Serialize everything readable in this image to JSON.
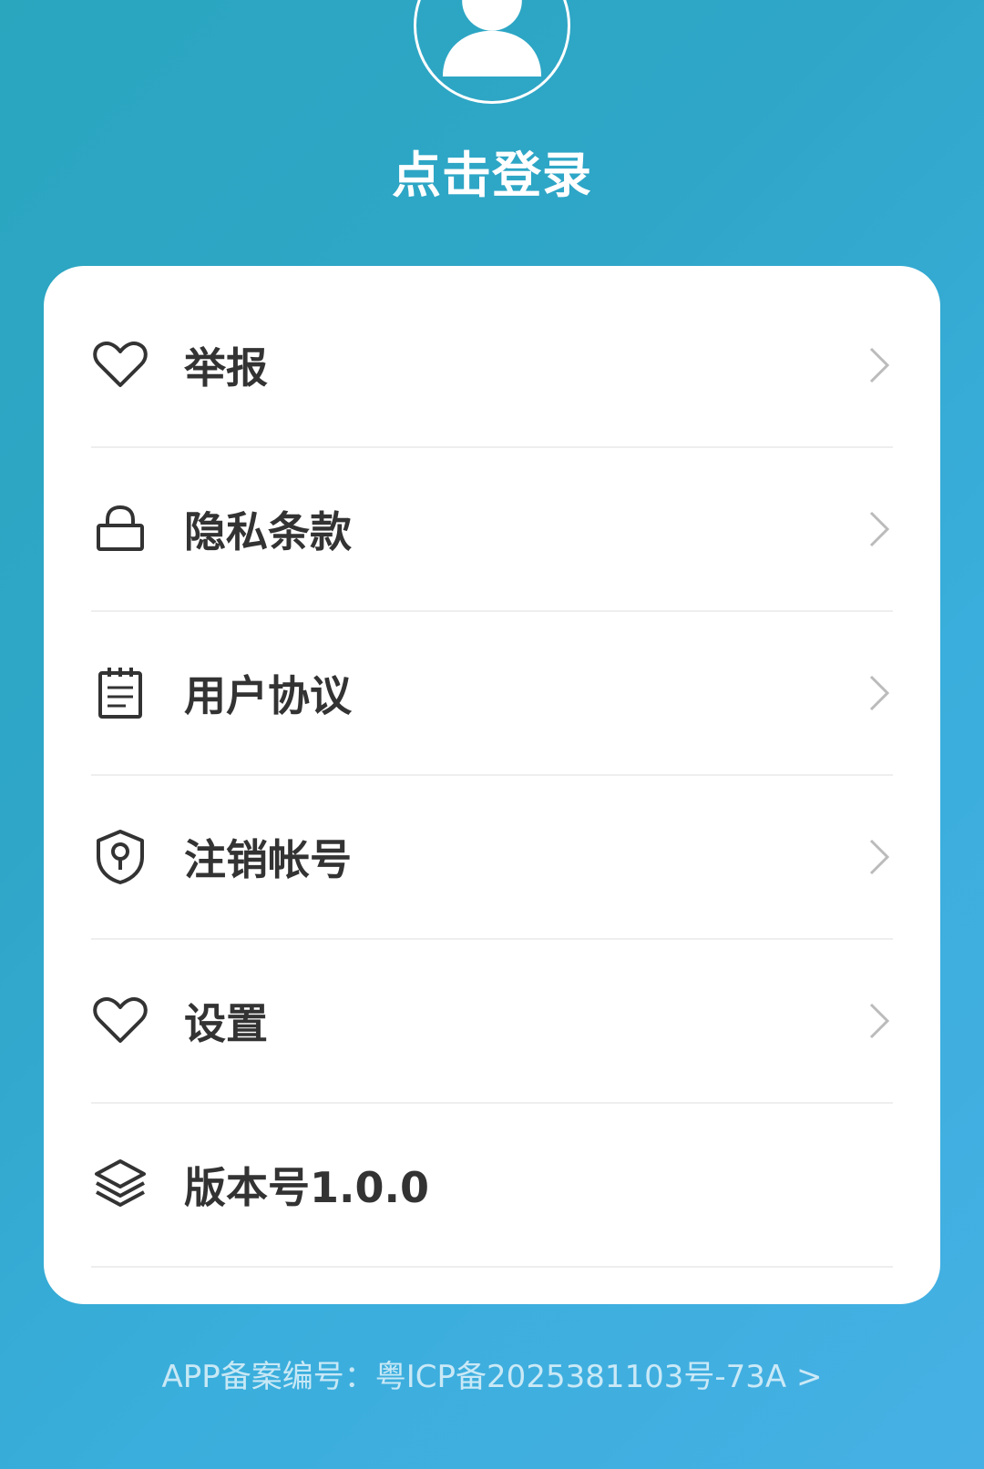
{
  "header": {
    "avatar_icon": "user-icon",
    "login_label": "点击登录"
  },
  "menu": {
    "items": [
      {
        "label": "举报",
        "icon": "heart-icon",
        "has_arrow": true
      },
      {
        "label": "隐私条款",
        "icon": "lock-icon",
        "has_arrow": true
      },
      {
        "label": "用户协议",
        "icon": "notepad-icon",
        "has_arrow": true
      },
      {
        "label": "注销帐号",
        "icon": "shield-key-icon",
        "has_arrow": true
      },
      {
        "label": "设置",
        "icon": "heart-icon",
        "has_arrow": true
      },
      {
        "label": "版本号1.0.0",
        "icon": "layers-icon",
        "has_arrow": false
      }
    ]
  },
  "footer": {
    "icp_text": "APP备案编号：粤ICP备2025381103号-73A >"
  },
  "colors": {
    "background_start": "#2aa6bf",
    "background_end": "#46b0e4",
    "card": "#ffffff",
    "label_text": "#333333",
    "divider": "#eeeeee"
  }
}
